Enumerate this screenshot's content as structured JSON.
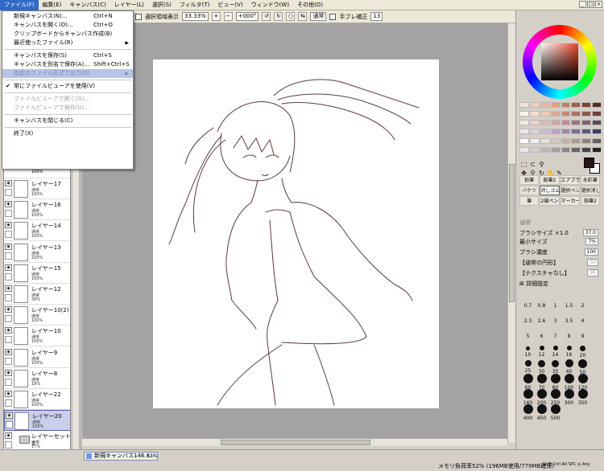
{
  "menubar": {
    "items": [
      "ファイル(F)",
      "編集(E)",
      "キャンバス(C)",
      "レイヤー(L)",
      "選択(S)",
      "フィルタ(T)",
      "ビュー(V)",
      "ウィンドウ(W)",
      "その他(O)"
    ]
  },
  "file_menu": {
    "items": [
      {
        "label": "新規キャンバス(N)...",
        "shortcut": "Ctrl+N"
      },
      {
        "label": "キャンバスを開く(O)...",
        "shortcut": "Ctrl+O"
      },
      {
        "label": "クリップボードからキャンバス作成(B)",
        "shortcut": ""
      },
      {
        "label": "最近使ったファイル(R)",
        "shortcut": ""
      },
      {
        "label": "キャンバスを保存(S)",
        "shortcut": "Ctrl+S"
      },
      {
        "label": "キャンバスを別名で保存(A)...",
        "shortcut": "Shift+Ctrl+S"
      },
      {
        "label": "指定のファイル形式で出力(E)",
        "shortcut": ""
      },
      {
        "label": "常にファイルビューアを使用(V)",
        "shortcut": ""
      },
      {
        "label": "ファイルビューアで開く(G)...",
        "shortcut": ""
      },
      {
        "label": "ファイルビューアで保存(U)...",
        "shortcut": ""
      },
      {
        "label": "キャンバスを閉じる(C)",
        "shortcut": ""
      },
      {
        "label": "終了(X)",
        "shortcut": ""
      }
    ]
  },
  "toolbar": {
    "selection_label": "選択領域表示",
    "zoom": "33.33%",
    "rotation": "+000°",
    "mode": "通常",
    "stabilizer_label": "手ブレ補正",
    "stabilizer_value": "13"
  },
  "layers": [
    {
      "name": "レイヤー17",
      "mode": "通常",
      "opacity": "100%"
    },
    {
      "name": "レイヤー16",
      "mode": "通常",
      "opacity": "100%"
    },
    {
      "name": "レイヤー14",
      "mode": "通常",
      "opacity": "100%"
    },
    {
      "name": "レイヤー13",
      "mode": "通常",
      "opacity": "100%"
    },
    {
      "name": "レイヤー15",
      "mode": "通常",
      "opacity": "100%"
    },
    {
      "name": "レイヤー12",
      "mode": "通常",
      "opacity": "34%"
    },
    {
      "name": "レイヤー10(2)",
      "mode": "通常",
      "opacity": "100%"
    },
    {
      "name": "レイヤー10",
      "mode": "通常",
      "opacity": "100%"
    },
    {
      "name": "レイヤー9",
      "mode": "通常",
      "opacity": "100%"
    },
    {
      "name": "レイヤー8",
      "mode": "通常",
      "opacity": "18%"
    },
    {
      "name": "レイヤー22",
      "mode": "通常",
      "opacity": "100%"
    },
    {
      "name": "レイヤー20",
      "mode": "通常",
      "opacity": "100%"
    },
    {
      "name": "レイヤーセット1",
      "mode": "通常",
      "opacity": "17%"
    }
  ],
  "layer_partial_opacity": "100%",
  "brushes": [
    "鉛筆",
    "鉛筆2",
    "エアブラシ",
    "水彩筆",
    "バケツ",
    "消しゴム",
    "選択ペン",
    "選択消し",
    "筆",
    "2値ペン",
    "マーカー",
    "鉛筆2"
  ],
  "brush_props": {
    "blend_label": "通常",
    "size_label": "ブラシサイズ",
    "size_mult": "×1.0",
    "size_value": "37.0",
    "min_label": "最小サイズ",
    "min_value": "7%",
    "density_label": "ブラシ濃度",
    "density_value": "100",
    "shape_label": "【通常の円形】",
    "shape_value": "50",
    "texture_label": "【テクスチャなし】",
    "texture_value": "95",
    "detail_label": "詳細設定"
  },
  "brush_size_labels": [
    "0.7",
    "0.8",
    "1",
    "1.5",
    "2",
    "2.3",
    "2.6",
    "3",
    "3.5",
    "4",
    "5",
    "6",
    "7",
    "8",
    "9",
    "10",
    "12",
    "14",
    "16",
    "20",
    "25",
    "30",
    "35",
    "40",
    "50",
    "60",
    "70",
    "80",
    "100",
    "120",
    "160",
    "200",
    "250",
    "300",
    "350",
    "400",
    "450",
    "500"
  ],
  "status": {
    "task_label": "新規キャンバス146.s...",
    "task_zoom": "33%",
    "memory": "メモリ負荷率52% (196MB使用/779MB確保)",
    "keys": "Shift Ctrl Alt SPC ◎ Any"
  },
  "colors": {
    "fg": "#2b1614",
    "highlight": "#316ac5"
  }
}
